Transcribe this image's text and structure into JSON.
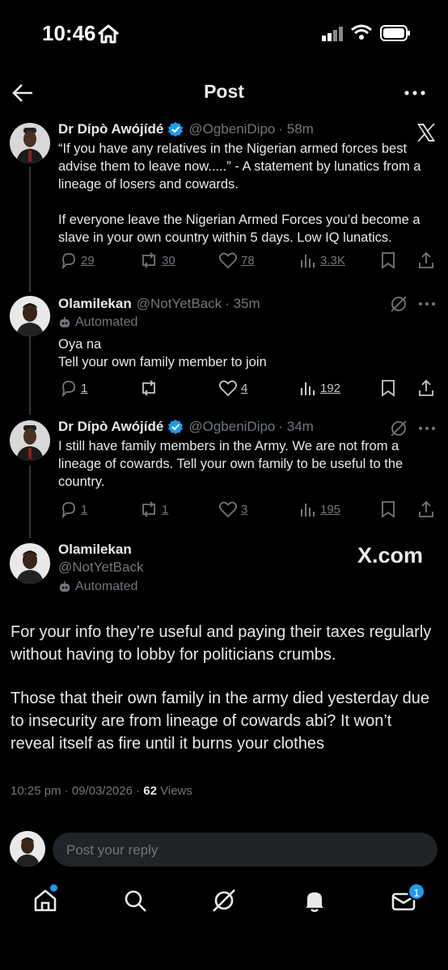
{
  "status_bar": {
    "time": "10:46"
  },
  "header": {
    "title": "Post"
  },
  "thread": [
    {
      "name": "Dr Dípò Awójídé",
      "handle": "@OgbeniDipo",
      "time": "· 58m",
      "text1": "“If you have any relatives in the Nigerian armed forces best advise them to leave now.....” - A statement by lunatics from a lineage of losers and cowards.",
      "text2": "If everyone leave the Nigerian Armed Forces you’d become a slave in your own country within 5 days. Low IQ lunatics.",
      "replies": "29",
      "reposts": "30",
      "likes": "78",
      "views": "3.3K"
    },
    {
      "name": "Olamilekan",
      "handle": "@NotYetBack",
      "time": "· 35m",
      "automated": "Automated",
      "text1": "Oya na",
      "text2": "Tell your own family member to join",
      "replies": "1",
      "likes": "4",
      "views": "192"
    },
    {
      "name": "Dr Dípò Awójídé",
      "handle": "@OgbeniDipo",
      "time": "· 34m",
      "text1": "I still have family members in the Army. We are not from a lineage of cowards. Tell your own family to be useful to the country.",
      "replies": "1",
      "reposts": "1",
      "likes": "3",
      "views": "195"
    }
  ],
  "main_post": {
    "name": "Olamilekan",
    "handle": "@NotYetBack",
    "automated": "Automated",
    "watermark": "X.com",
    "para1": "For your info they’re useful and paying their taxes regularly without having to lobby for politicians crumbs.",
    "para2": "Those that their own family in the army died yesterday due to insecurity are from lineage of cowards abi? It won’t reveal itself as fire until it burns your clothes",
    "timestamp": "10:25 pm · 09/03/2026 · ",
    "views_count": "62",
    "views_label": " Views"
  },
  "reply_bar": {
    "placeholder": "Post your reply"
  },
  "nav": {
    "messages_badge": "1"
  },
  "colors": {
    "accent": "#1d9bf0",
    "background": "#000000",
    "muted": "#71767b"
  },
  "icons": [
    "back-arrow-icon",
    "more-icon",
    "x-logo-icon",
    "verified-icon",
    "reply-icon",
    "repost-icon",
    "like-icon",
    "views-icon",
    "bookmark-icon",
    "share-icon",
    "grok-icon",
    "robot-icon",
    "home-icon",
    "search-icon",
    "bell-icon",
    "mail-icon"
  ]
}
